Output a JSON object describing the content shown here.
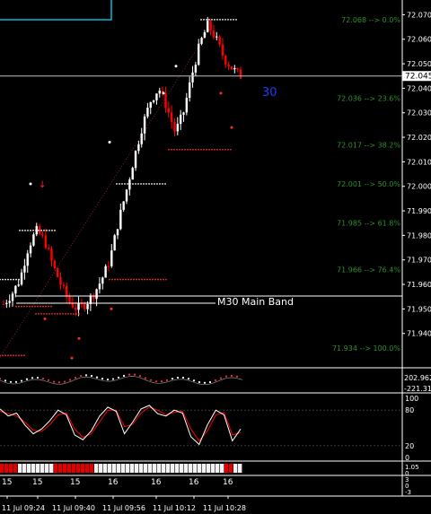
{
  "chart_data": {
    "type": "line",
    "note_symbol": "candlestick",
    "colors": {
      "background": "#000000",
      "axis_text": "#ffffff",
      "bull": "#ffffff",
      "bear": "#ff0000",
      "fib": "#2f8f2f",
      "band": "#ffffff",
      "mtf": "#00bcd4",
      "stoch_main": "#ffffff",
      "stoch_signal": "#ff0000",
      "dots_red": "#ff2a2a",
      "dots_white": "#ffffff",
      "period_label": "#1f3cff"
    },
    "price_axis": {
      "ylim": [
        71.926,
        72.076
      ],
      "ticks": [
        "72.070",
        "72.060",
        "72.050",
        "72.040",
        "72.030",
        "72.020",
        "72.010",
        "72.000",
        "71.990",
        "71.980",
        "71.970",
        "71.960",
        "71.950",
        "71.940"
      ],
      "current_price": "72.045"
    },
    "period_label": "30",
    "band_label": "M30 Main Band",
    "fib_levels": [
      {
        "label": "72.068 --> 0.0%",
        "price": 72.068
      },
      {
        "label": "72.036 --> 23.6%",
        "price": 72.036
      },
      {
        "label": "72.017 --> 38.2%",
        "price": 72.017
      },
      {
        "label": "72.001 --> 50.0%",
        "price": 72.001
      },
      {
        "label": "71.985 --> 61.8%",
        "price": 71.985
      },
      {
        "label": "71.966 --> 76.4%",
        "price": 71.966
      },
      {
        "label": "71.934 --> 100.0%",
        "price": 71.934
      }
    ],
    "osc1": {
      "top_label": "202.9624",
      "bottom_label": "-221.314"
    },
    "osc2": {
      "ticks": [
        "100",
        "80",
        "20",
        "0"
      ]
    },
    "osc3": {
      "ticks": [
        "1.05",
        "0"
      ]
    },
    "osc4": {
      "ticks": [
        "3",
        "0",
        "-3"
      ]
    },
    "x_axis": {
      "top_labels": [
        "15",
        "15",
        "15",
        "16",
        "16",
        "16",
        "16"
      ],
      "bottom_labels": [
        "11 Jul 09:24",
        "11 Jul 09:40",
        "11 Jul 09:56",
        "11 Jul 10:12",
        "11 Jul 10:28"
      ]
    },
    "price_path": [
      71.952,
      71.956,
      71.962,
      71.975,
      71.982,
      71.978,
      71.968,
      71.96,
      71.953,
      71.95,
      71.952,
      71.956,
      71.962,
      71.97,
      71.985,
      71.998,
      72.012,
      72.025,
      72.035,
      72.04,
      72.032,
      72.022,
      72.03,
      72.045,
      72.058,
      72.066,
      72.06,
      72.052,
      72.048,
      72.045
    ],
    "stoch_main": [
      82,
      70,
      75,
      55,
      40,
      48,
      62,
      80,
      72,
      38,
      30,
      45,
      70,
      85,
      78,
      40,
      60,
      82,
      88,
      74,
      70,
      80,
      75,
      35,
      22,
      55,
      80,
      72,
      28,
      48
    ],
    "stoch_signal": [
      78,
      74,
      70,
      60,
      46,
      44,
      55,
      72,
      75,
      48,
      34,
      40,
      60,
      80,
      80,
      52,
      56,
      75,
      85,
      80,
      72,
      76,
      78,
      48,
      28,
      45,
      72,
      76,
      38,
      42
    ],
    "heat_blocks": [
      "r",
      "r",
      "r",
      "r",
      "w",
      "w",
      "w",
      "w",
      "w",
      "w",
      "w",
      "w",
      "r",
      "r",
      "r",
      "r",
      "r",
      "r",
      "r",
      "r",
      "r",
      "w",
      "w",
      "w",
      "w",
      "w",
      "w",
      "w",
      "w",
      "w",
      "w",
      "w",
      "w",
      "w",
      "w",
      "w",
      "w",
      "w",
      "w",
      "w",
      "w",
      "w",
      "w",
      "w",
      "w",
      "w",
      "w",
      "w",
      "w",
      "w",
      "r",
      "r",
      "w",
      "w"
    ]
  }
}
